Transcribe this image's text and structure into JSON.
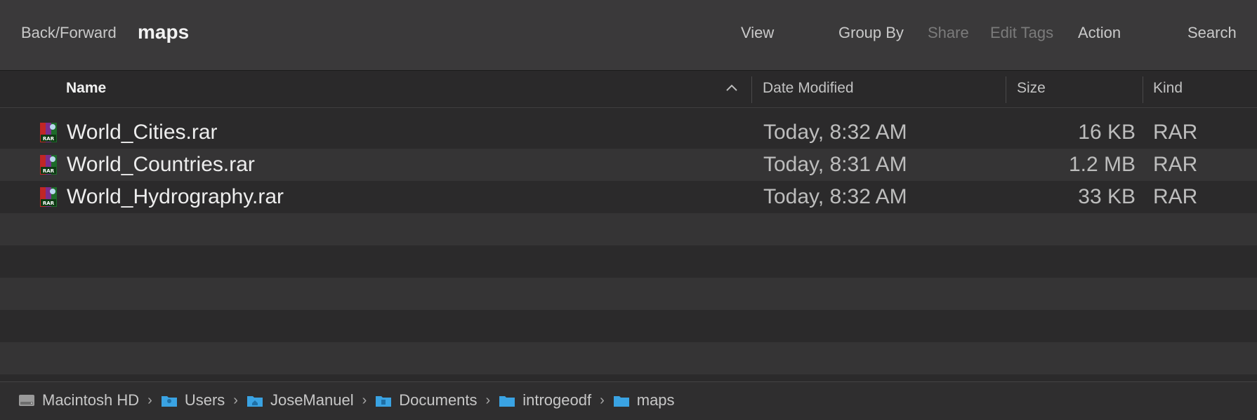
{
  "toolbar": {
    "nav_label": "Back/Forward",
    "title": "maps",
    "view": "View",
    "group_by": "Group By",
    "share": "Share",
    "edit_tags": "Edit Tags",
    "action": "Action",
    "search": "Search"
  },
  "columns": {
    "name": "Name",
    "date": "Date Modified",
    "size": "Size",
    "kind": "Kind"
  },
  "files": [
    {
      "name": "World_Cities.rar",
      "date": "Today, 8:32 AM",
      "size": "16 KB",
      "kind": "RAR",
      "icon": "rar-archive-icon"
    },
    {
      "name": "World_Countries.rar",
      "date": "Today, 8:31 AM",
      "size": "1.2 MB",
      "kind": "RAR",
      "icon": "rar-archive-icon"
    },
    {
      "name": "World_Hydrography.rar",
      "date": "Today, 8:32 AM",
      "size": "33 KB",
      "kind": "RAR",
      "icon": "rar-archive-icon"
    }
  ],
  "path": [
    {
      "label": "Macintosh HD",
      "icon": "hard-drive-icon"
    },
    {
      "label": "Users",
      "icon": "folder-icon"
    },
    {
      "label": "JoseManuel",
      "icon": "home-folder-icon"
    },
    {
      "label": "Documents",
      "icon": "folder-icon"
    },
    {
      "label": "introgeodf",
      "icon": "folder-icon"
    },
    {
      "label": "maps",
      "icon": "folder-icon"
    }
  ],
  "colors": {
    "background": "#2b2a2b",
    "toolbar": "#3a393a",
    "row_alt": "#353435",
    "folder_blue": "#3aa3e3"
  }
}
